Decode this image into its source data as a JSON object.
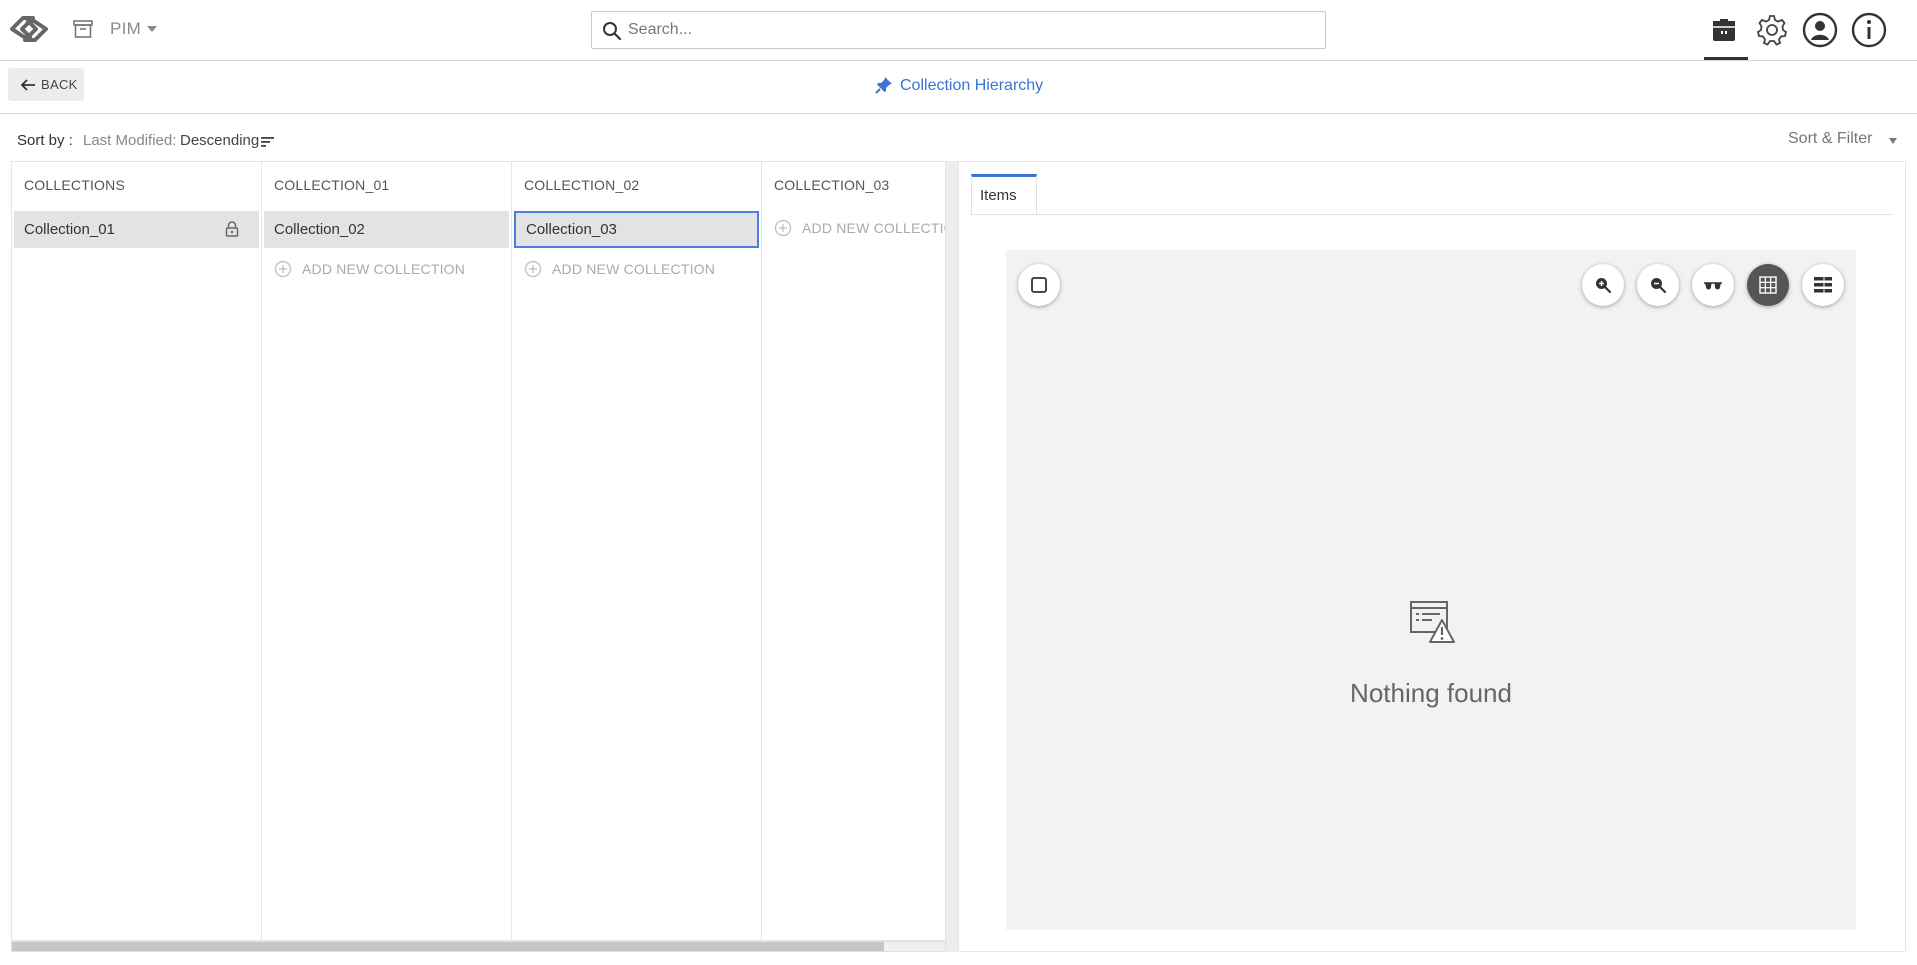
{
  "header": {
    "app_menu": "PIM",
    "search": {
      "placeholder": "Search..."
    }
  },
  "subbar": {
    "back_label": "BACK",
    "title": "Collection Hierarchy"
  },
  "sort": {
    "label": "Sort by :",
    "field": "Last Modified:",
    "order": "Descending",
    "filter_label": "Sort & Filter"
  },
  "columns": [
    {
      "header": "COLLECTIONS",
      "item": "Collection_01",
      "locked": true
    },
    {
      "header": "COLLECTION_01",
      "item": "Collection_02",
      "add_label": "ADD NEW COLLECTION"
    },
    {
      "header": "COLLECTION_02",
      "item": "Collection_03",
      "selected": true,
      "add_label": "ADD NEW COLLECTION"
    },
    {
      "header": "COLLECTION_03",
      "add_label": "ADD NEW COLLECTION"
    }
  ],
  "panel": {
    "tab": "Items",
    "empty_message": "Nothing found",
    "toolbar_icons": [
      "zoom-in-icon",
      "zoom-out-icon",
      "glasses-icon",
      "grid-view-icon",
      "list-view-icon"
    ],
    "active_view": "grid-view-icon"
  },
  "colors": {
    "accent": "#3b73d6",
    "selected_border": "#4a7fe0",
    "item_bg": "#e3e3e3"
  }
}
